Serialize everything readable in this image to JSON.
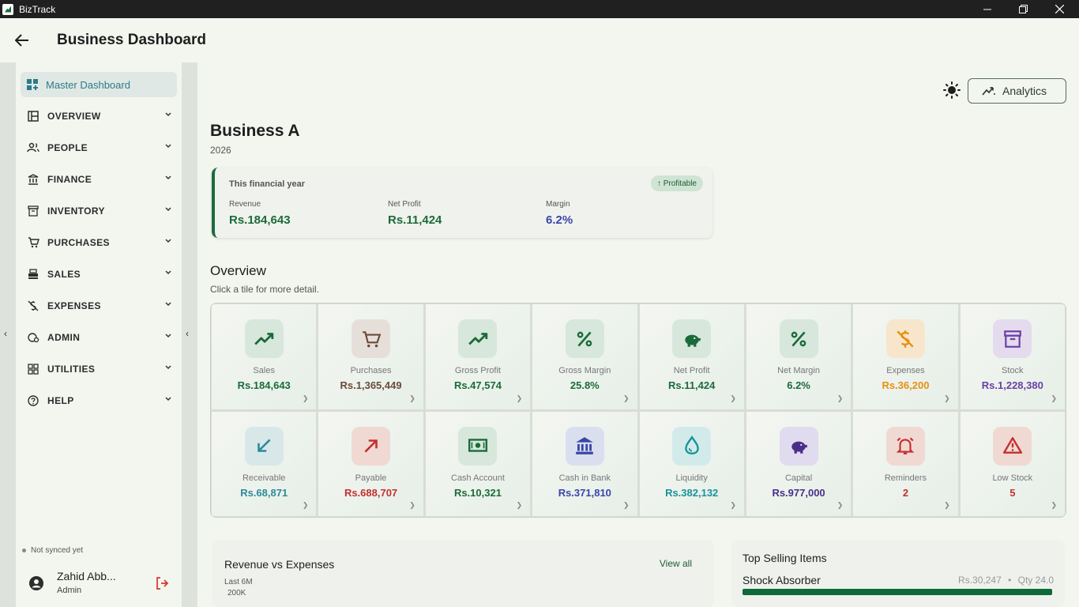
{
  "window": {
    "title": "BizTrack",
    "minimize": "—",
    "maximize": "❐",
    "close": "✕"
  },
  "header": {
    "title": "Business Dashboard"
  },
  "sidebar": {
    "master": "Master Dashboard",
    "items": [
      {
        "label": "OVERVIEW",
        "icon": "layout-icon"
      },
      {
        "label": "PEOPLE",
        "icon": "people-icon"
      },
      {
        "label": "FINANCE",
        "icon": "bank-icon"
      },
      {
        "label": "INVENTORY",
        "icon": "archive-icon"
      },
      {
        "label": "PURCHASES",
        "icon": "cart-icon"
      },
      {
        "label": "SALES",
        "icon": "register-icon"
      },
      {
        "label": "EXPENSES",
        "icon": "money-off-icon"
      },
      {
        "label": "ADMIN",
        "icon": "admin-icon"
      },
      {
        "label": "UTILITIES",
        "icon": "apps-icon"
      },
      {
        "label": "HELP",
        "icon": "help-icon"
      }
    ],
    "sync_status": "Not synced yet",
    "user": {
      "name": "Zahid Abb...",
      "role": "Admin"
    }
  },
  "toolbar": {
    "analytics": "Analytics"
  },
  "business": {
    "name": "Business A",
    "year": "2026"
  },
  "financial_year": {
    "heading": "This financial year",
    "badge": "↑ Profitable",
    "revenue_label": "Revenue",
    "revenue": "Rs.184,643",
    "profit_label": "Net Profit",
    "profit": "Rs.11,424",
    "margin_label": "Margin",
    "margin": "6.2%"
  },
  "overview": {
    "title": "Overview",
    "subtitle": "Click a tile for more detail.",
    "tiles": [
      {
        "label": "Sales",
        "value": "Rs.184,643",
        "icon": "trend-up-icon",
        "color": "#1b6b3a",
        "bg": "#d7e7dc"
      },
      {
        "label": "Purchases",
        "value": "Rs.1,365,449",
        "icon": "cart-icon",
        "color": "#6b4a3a",
        "bg": "#e6dfd9"
      },
      {
        "label": "Gross Profit",
        "value": "Rs.47,574",
        "icon": "trend-up-icon",
        "color": "#1b6b3a",
        "bg": "#d7e7dc"
      },
      {
        "label": "Gross Margin",
        "value": "25.8%",
        "icon": "percent-icon",
        "color": "#1b6b3a",
        "bg": "#d7e7dc"
      },
      {
        "label": "Net Profit",
        "value": "Rs.11,424",
        "icon": "piggy-bank-icon",
        "color": "#1b6b3a",
        "bg": "#d7e7dc"
      },
      {
        "label": "Net Margin",
        "value": "6.2%",
        "icon": "percent-icon",
        "color": "#1b6b3a",
        "bg": "#d7e7dc"
      },
      {
        "label": "Expenses",
        "value": "Rs.36,200",
        "icon": "money-off-icon",
        "color": "#e8900f",
        "bg": "#f7e6cc"
      },
      {
        "label": "Stock",
        "value": "Rs.1,228,380",
        "icon": "archive-icon",
        "color": "#6a3fa6",
        "bg": "#e4dbee"
      },
      {
        "label": "Receivable",
        "value": "Rs.68,871",
        "icon": "arrow-down-left-icon",
        "color": "#2e8a9a",
        "bg": "#d8e8e8"
      },
      {
        "label": "Payable",
        "value": "Rs.688,707",
        "icon": "arrow-up-right-icon",
        "color": "#c53030",
        "bg": "#f0d9d3"
      },
      {
        "label": "Cash Account",
        "value": "Rs.10,321",
        "icon": "cash-icon",
        "color": "#1b6b3a",
        "bg": "#d7e7dc"
      },
      {
        "label": "Cash in Bank",
        "value": "Rs.371,810",
        "icon": "bank-icon",
        "color": "#3a46a8",
        "bg": "#dadff0"
      },
      {
        "label": "Liquidity",
        "value": "Rs.382,132",
        "icon": "drop-icon",
        "color": "#19939a",
        "bg": "#d2ebea"
      },
      {
        "label": "Capital",
        "value": "Rs.977,000",
        "icon": "piggy-bank-icon",
        "color": "#4a2f8a",
        "bg": "#e0dbee"
      },
      {
        "label": "Reminders",
        "value": "2",
        "icon": "alarm-icon",
        "color": "#c53030",
        "bg": "#f0d9d3"
      },
      {
        "label": "Low Stock",
        "value": "5",
        "icon": "warning-icon",
        "color": "#c53030",
        "bg": "#f0d9d3"
      }
    ]
  },
  "revenue_expenses": {
    "title": "Revenue vs Expenses",
    "view_all": "View all",
    "period": "Last 6M",
    "axis_top": "200K"
  },
  "top_selling": {
    "title": "Top Selling Items",
    "item": "Shock Absorber",
    "value": "Rs.30,247",
    "sep": "•",
    "qty": "Qty 24.0"
  }
}
